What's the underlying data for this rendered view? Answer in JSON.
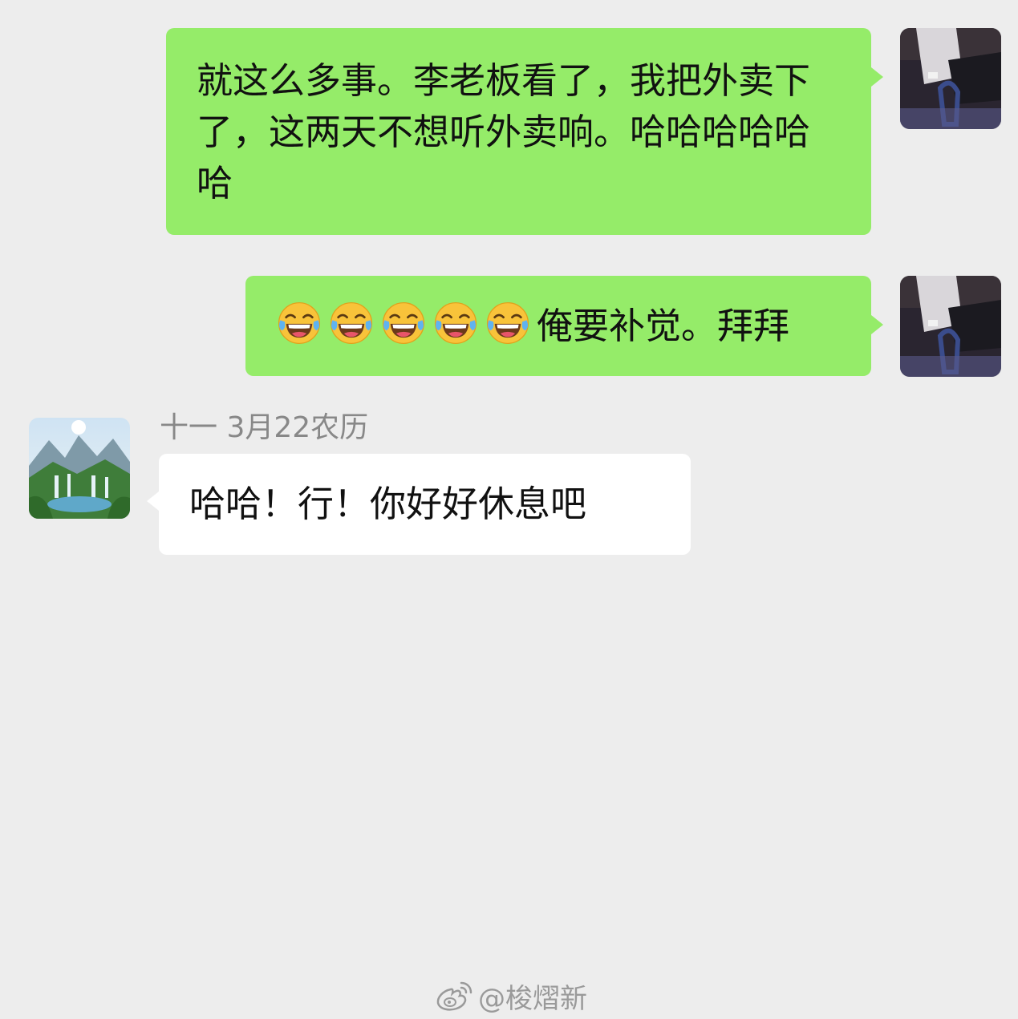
{
  "messages": [
    {
      "direction": "outgoing",
      "text": "就这么多事。李老板看了，我把外卖下了，这两天不想听外卖响。哈哈哈哈哈哈"
    },
    {
      "direction": "outgoing",
      "emoji": "face-with-tears-of-joy",
      "emoji_count": 5,
      "text": "俺要补觉。拜拜"
    },
    {
      "direction": "incoming",
      "sender_name": "十一 3月22农历",
      "text": "哈哈！行！你好好休息吧"
    }
  ],
  "watermark": {
    "logo": "weibo-logo",
    "text": "@梭熠新"
  },
  "colors": {
    "background": "#ededed",
    "outgoing_bubble": "#95ec69",
    "incoming_bubble": "#ffffff",
    "sender_name": "#888888"
  }
}
